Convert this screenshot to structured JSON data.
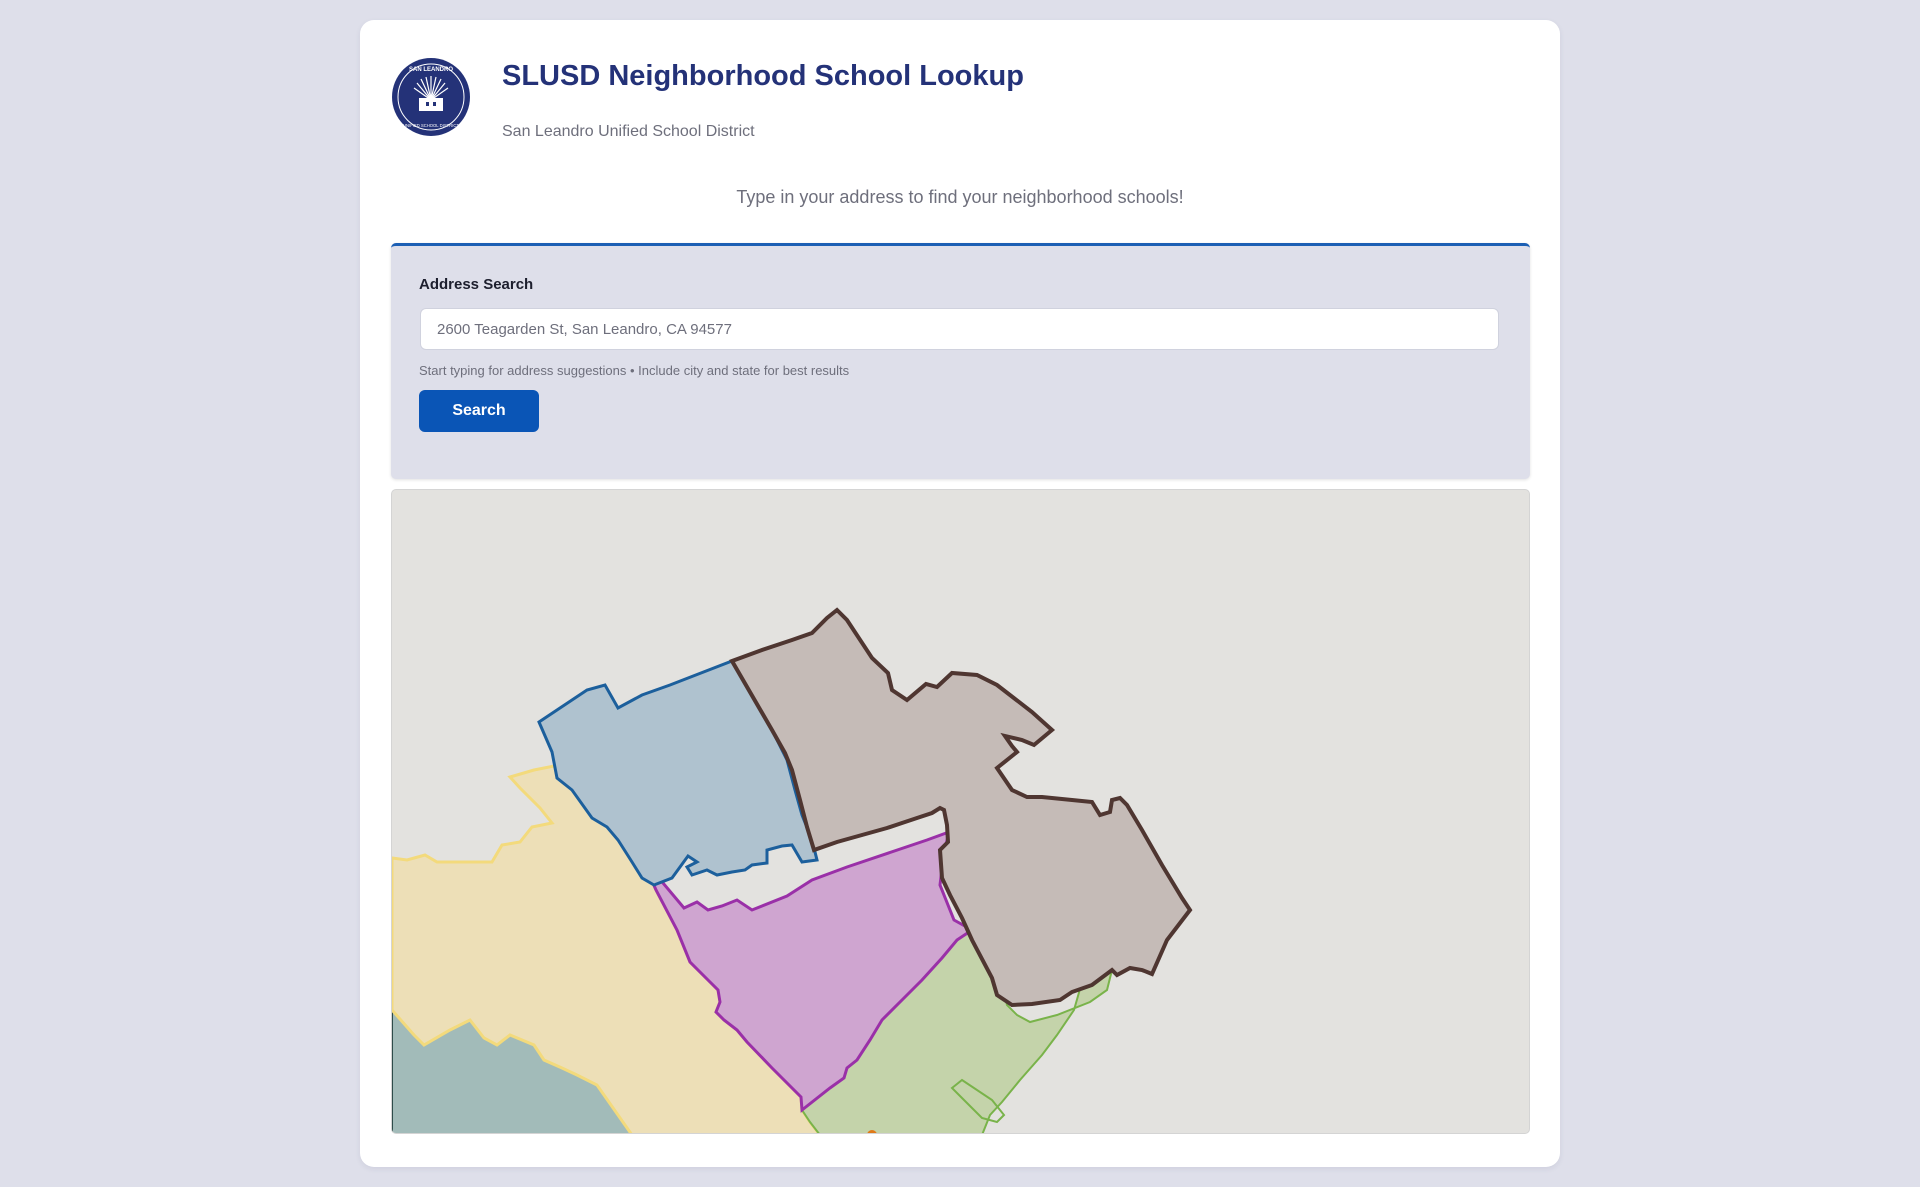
{
  "header": {
    "title": "SLUSD Neighborhood School Lookup",
    "subtitle": "San Leandro Unified School District",
    "logo_text_top": "SAN LEANDRO",
    "logo_text_bottom": "UNIFIED SCHOOL DISTRICT"
  },
  "tagline": "Type in your address to find your neighborhood schools!",
  "search": {
    "label": "Address Search",
    "placeholder": "2600 Teagarden St, San Leandro, CA 94577",
    "value": "",
    "hint": "Start typing for address suggestions • Include city and state for best results",
    "button_label": "Search"
  },
  "map": {
    "icon": "school-boundary-map",
    "zones": [
      {
        "name": "blue-zone",
        "fill": "#afc2cf",
        "stroke": "#1c5f9c"
      },
      {
        "name": "brown-zone",
        "fill": "#c5bbb7",
        "stroke": "#4f3631"
      },
      {
        "name": "purple-zone",
        "fill": "#cfa5d0",
        "stroke": "#9a30a8"
      },
      {
        "name": "yellow-zone",
        "fill": "#eddfb7",
        "stroke": "#f3da7c"
      },
      {
        "name": "green-zone",
        "fill": "#c4d3aa",
        "stroke": "#79b34a"
      },
      {
        "name": "teal-zone",
        "fill": "#a2bbb9",
        "stroke": "#2e4c4a"
      }
    ]
  },
  "colors": {
    "page_background": "#dedfea",
    "title": "#243278",
    "accent": "#0a55b6"
  }
}
